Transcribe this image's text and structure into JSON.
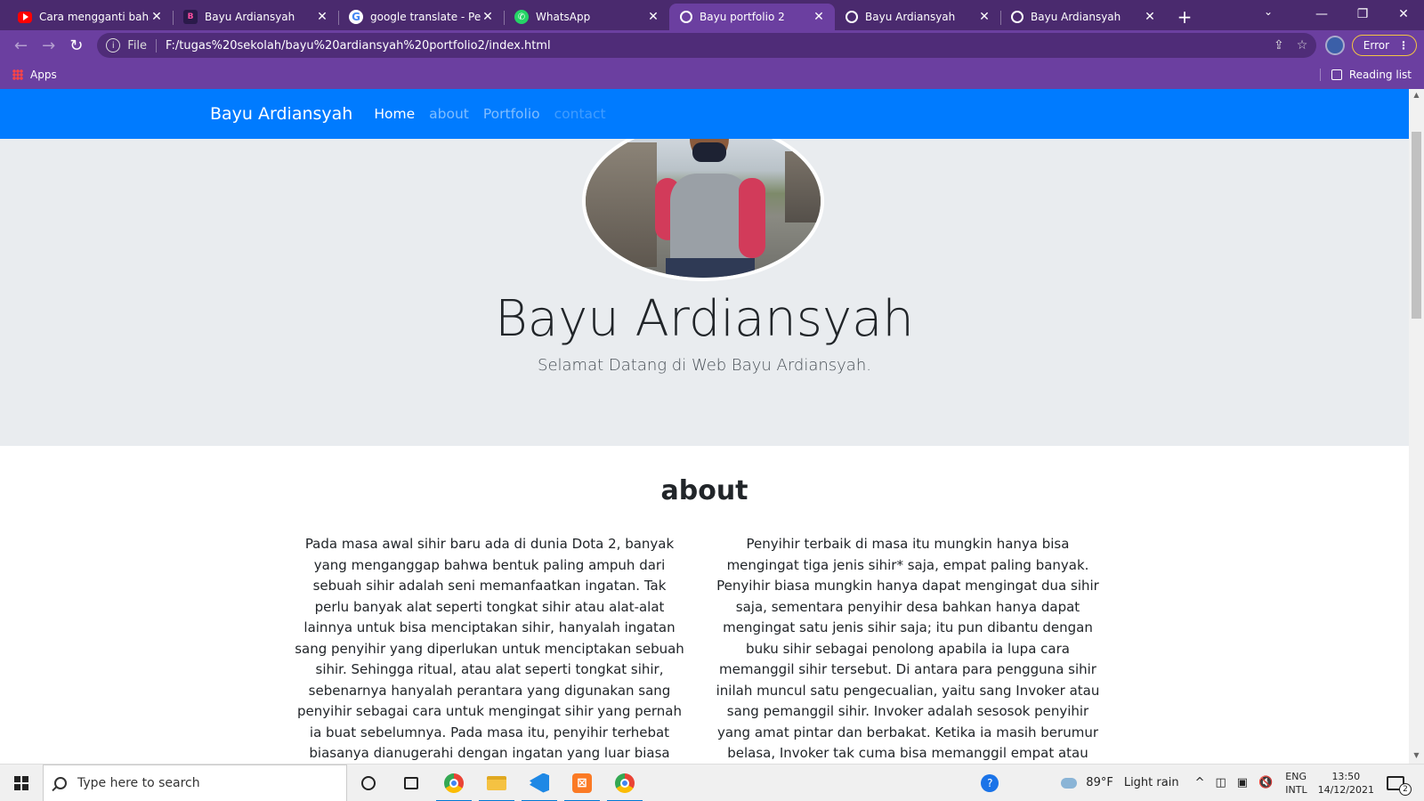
{
  "browser": {
    "tabs": [
      {
        "title": "Cara mengganti bahasa",
        "favicon": "youtube-icon",
        "active": false
      },
      {
        "title": "Bayu Ardiansyah",
        "favicon": "bayu-icon",
        "active": false
      },
      {
        "title": "google translate - Pene",
        "favicon": "google-icon",
        "active": false
      },
      {
        "title": "WhatsApp",
        "favicon": "whatsapp-icon",
        "active": false
      },
      {
        "title": "Bayu portfolio 2",
        "favicon": "globe-icon",
        "active": true
      },
      {
        "title": "Bayu Ardiansyah",
        "favicon": "globe-icon",
        "active": false
      },
      {
        "title": "Bayu Ardiansyah",
        "favicon": "globe-icon",
        "active": false
      }
    ],
    "new_tab": "+",
    "address": {
      "scheme_label": "File",
      "url": "F:/tugas%20sekolah/bayu%20ardiansyah%20portfolio2/index.html"
    },
    "error_label": "Error",
    "bookmarks": {
      "apps_label": "Apps",
      "reading_list_label": "Reading list"
    },
    "colors": {
      "frame": "#4a2a6e",
      "toolbar": "#6b3fa0"
    }
  },
  "page": {
    "navbar": {
      "brand": "Bayu Ardiansyah",
      "links": [
        {
          "label": "Home",
          "state": "active"
        },
        {
          "label": "about",
          "state": "normal"
        },
        {
          "label": "Portfolio",
          "state": "normal"
        },
        {
          "label": "contact",
          "state": "faint"
        }
      ],
      "color": "#007bff"
    },
    "hero": {
      "name": "Bayu Ardiansyah",
      "subtitle": "Selamat Datang di Web Bayu Ardiansyah."
    },
    "about": {
      "title": "about",
      "left_text": "Pada masa awal sihir baru ada di dunia Dota 2, banyak yang menganggap bahwa bentuk paling ampuh dari sebuah sihir adalah seni memanfaatkan ingatan. Tak perlu banyak alat seperti tongkat sihir atau alat-alat lainnya untuk bisa menciptakan sihir, hanyalah ingatan sang penyihir yang diperlukan untuk menciptakan sebuah sihir. Sehingga ritual, atau alat seperti tongkat sihir, sebenarnya hanyalah perantara yang digunakan sang penyihir sebagai cara untuk mengingat sihir yang pernah ia buat sebelumnya. Pada masa itu, penyihir terhebat biasanya dianugerahi dengan ingatan yang luar biasa",
      "right_text": "Penyihir terbaik di masa itu mungkin hanya bisa mengingat tiga jenis sihir* saja, empat paling banyak. Penyihir biasa mungkin hanya dapat mengingat dua sihir saja, sementara penyihir desa bahkan hanya dapat mengingat satu jenis sihir saja; itu pun dibantu dengan buku sihir sebagai penolong apabila ia lupa cara memanggil sihir tersebut. Di antara para pengguna sihir inilah muncul satu pengecualian, yaitu sang Invoker atau sang pemanggil sihir. Invoker adalah sesosok penyihir yang amat pintar dan berbakat. Ketika ia masih berumur belasa, Invoker tak cuma bisa memanggil empat atau"
    }
  },
  "taskbar": {
    "search_placeholder": "Type here to search",
    "weather": {
      "temp": "89°F",
      "condition": "Light rain"
    },
    "language": {
      "line1": "ENG",
      "line2": "INTL"
    },
    "clock": {
      "time": "13:50",
      "date": "14/12/2021"
    },
    "notification_count": "2"
  }
}
